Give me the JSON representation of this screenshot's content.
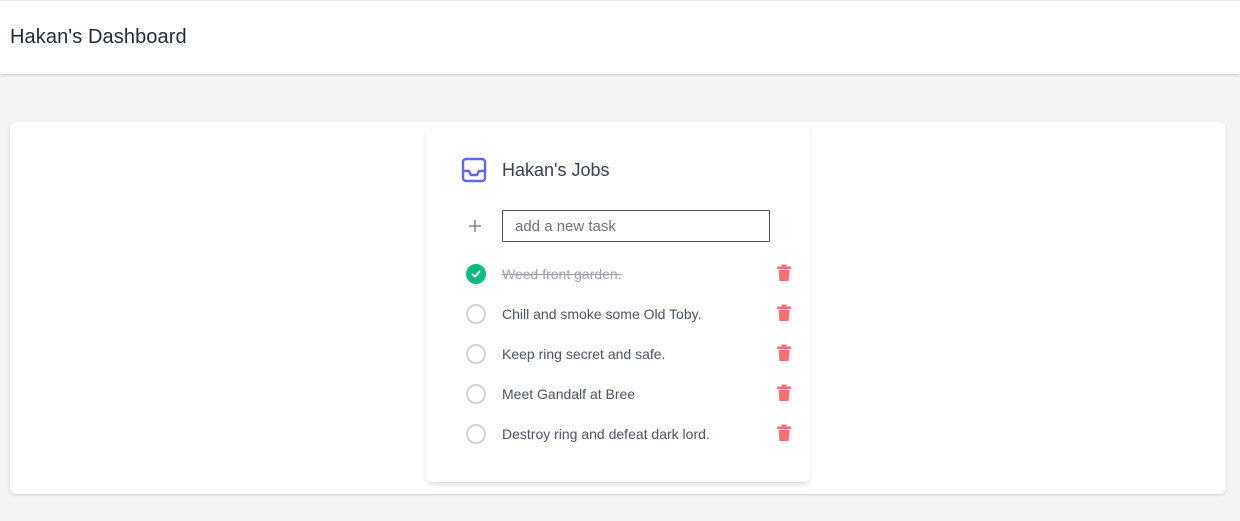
{
  "header": {
    "title": "Hakan's Dashboard"
  },
  "card": {
    "title": "Hakan's Jobs",
    "icon": "inbox-icon",
    "accent_color": "#6366f1"
  },
  "new_task": {
    "placeholder": "add a new task",
    "value": "",
    "icon": "plus-icon"
  },
  "tasks": [
    {
      "label": "Weed front garden.",
      "completed": true
    },
    {
      "label": "Chill and smoke some Old Toby.",
      "completed": false
    },
    {
      "label": "Keep ring secret and safe.",
      "completed": false
    },
    {
      "label": "Meet Gandalf at Bree",
      "completed": false
    },
    {
      "label": "Destroy ring and defeat dark lord.",
      "completed": false
    }
  ],
  "colors": {
    "complete": "#10b981",
    "delete": "#f87171",
    "accent": "#6366f1"
  },
  "icons": {
    "complete": "check-icon",
    "delete": "trash-icon"
  }
}
